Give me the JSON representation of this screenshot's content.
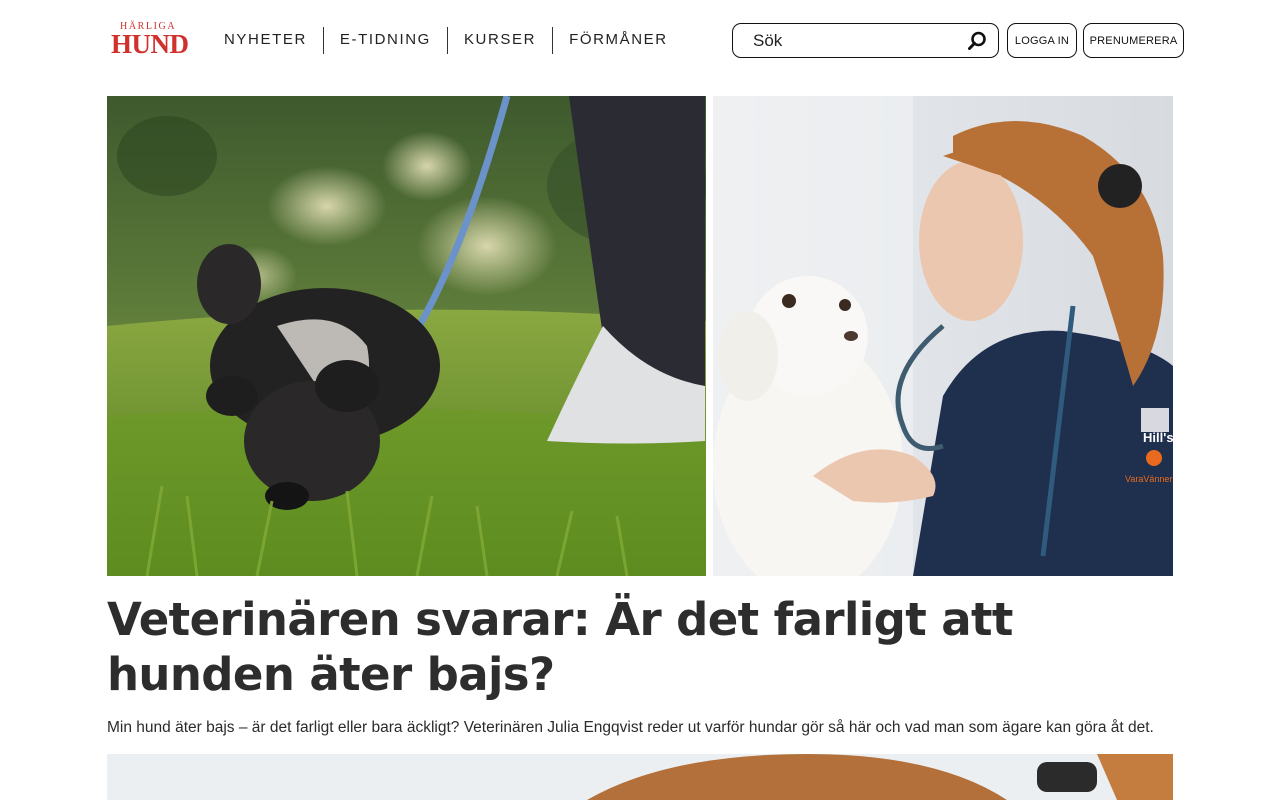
{
  "brand": {
    "top": "HÄRLIGA",
    "main": "HUND",
    "color": "#d0312d"
  },
  "nav": {
    "items": [
      "NYHETER",
      "E-TIDNING",
      "KURSER",
      "FÖRMÅNER"
    ]
  },
  "search": {
    "placeholder": "Sök",
    "icon": "search-icon"
  },
  "header_buttons": {
    "login": "LOGGA IN",
    "subscribe": "PRENUMERERA"
  },
  "hero": {
    "left_image": "black dog sniffing grass on leash",
    "right_image": "veterinarian with white dog",
    "scrub_logo": "Hill's",
    "scrub_text": "VaraVänner"
  },
  "article": {
    "headline": "Veterinären svarar: Är det farligt att hunden äter bajs?",
    "lead": "Min hund äter bajs – är det farligt eller bara äckligt? Veterinären Julia Engqvist reder ut varför hundar gör så här och vad man som ägare kan göra åt det."
  }
}
